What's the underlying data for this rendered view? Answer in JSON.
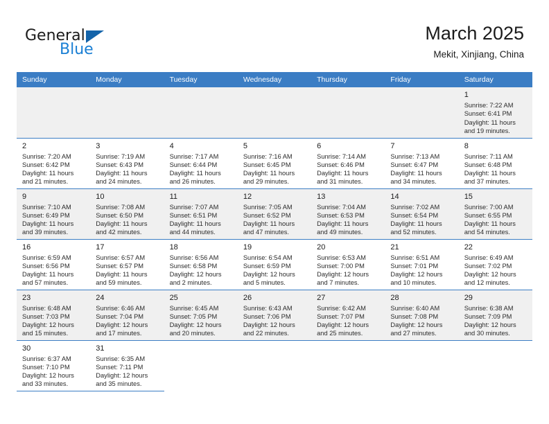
{
  "brand": {
    "name_part1": "General",
    "name_part2": "Blue",
    "triangle_color": "#1464aa",
    "blue_color": "#1a7fd4"
  },
  "header": {
    "title": "March 2025",
    "subtitle": "Mekit, Xinjiang, China"
  },
  "theme": {
    "header_bg": "#3b7dc4",
    "row_shade": "#f0f0f0",
    "grid_line": "#3b7dc4"
  },
  "weekdays": [
    "Sunday",
    "Monday",
    "Tuesday",
    "Wednesday",
    "Thursday",
    "Friday",
    "Saturday"
  ],
  "weeks": [
    [
      {
        "blank": true
      },
      {
        "blank": true
      },
      {
        "blank": true
      },
      {
        "blank": true
      },
      {
        "blank": true
      },
      {
        "blank": true
      },
      {
        "day": "1",
        "sunrise": "Sunrise: 7:22 AM",
        "sunset": "Sunset: 6:41 PM",
        "daylight1": "Daylight: 11 hours",
        "daylight2": "and 19 minutes."
      }
    ],
    [
      {
        "day": "2",
        "sunrise": "Sunrise: 7:20 AM",
        "sunset": "Sunset: 6:42 PM",
        "daylight1": "Daylight: 11 hours",
        "daylight2": "and 21 minutes."
      },
      {
        "day": "3",
        "sunrise": "Sunrise: 7:19 AM",
        "sunset": "Sunset: 6:43 PM",
        "daylight1": "Daylight: 11 hours",
        "daylight2": "and 24 minutes."
      },
      {
        "day": "4",
        "sunrise": "Sunrise: 7:17 AM",
        "sunset": "Sunset: 6:44 PM",
        "daylight1": "Daylight: 11 hours",
        "daylight2": "and 26 minutes."
      },
      {
        "day": "5",
        "sunrise": "Sunrise: 7:16 AM",
        "sunset": "Sunset: 6:45 PM",
        "daylight1": "Daylight: 11 hours",
        "daylight2": "and 29 minutes."
      },
      {
        "day": "6",
        "sunrise": "Sunrise: 7:14 AM",
        "sunset": "Sunset: 6:46 PM",
        "daylight1": "Daylight: 11 hours",
        "daylight2": "and 31 minutes."
      },
      {
        "day": "7",
        "sunrise": "Sunrise: 7:13 AM",
        "sunset": "Sunset: 6:47 PM",
        "daylight1": "Daylight: 11 hours",
        "daylight2": "and 34 minutes."
      },
      {
        "day": "8",
        "sunrise": "Sunrise: 7:11 AM",
        "sunset": "Sunset: 6:48 PM",
        "daylight1": "Daylight: 11 hours",
        "daylight2": "and 37 minutes."
      }
    ],
    [
      {
        "day": "9",
        "sunrise": "Sunrise: 7:10 AM",
        "sunset": "Sunset: 6:49 PM",
        "daylight1": "Daylight: 11 hours",
        "daylight2": "and 39 minutes."
      },
      {
        "day": "10",
        "sunrise": "Sunrise: 7:08 AM",
        "sunset": "Sunset: 6:50 PM",
        "daylight1": "Daylight: 11 hours",
        "daylight2": "and 42 minutes."
      },
      {
        "day": "11",
        "sunrise": "Sunrise: 7:07 AM",
        "sunset": "Sunset: 6:51 PM",
        "daylight1": "Daylight: 11 hours",
        "daylight2": "and 44 minutes."
      },
      {
        "day": "12",
        "sunrise": "Sunrise: 7:05 AM",
        "sunset": "Sunset: 6:52 PM",
        "daylight1": "Daylight: 11 hours",
        "daylight2": "and 47 minutes."
      },
      {
        "day": "13",
        "sunrise": "Sunrise: 7:04 AM",
        "sunset": "Sunset: 6:53 PM",
        "daylight1": "Daylight: 11 hours",
        "daylight2": "and 49 minutes."
      },
      {
        "day": "14",
        "sunrise": "Sunrise: 7:02 AM",
        "sunset": "Sunset: 6:54 PM",
        "daylight1": "Daylight: 11 hours",
        "daylight2": "and 52 minutes."
      },
      {
        "day": "15",
        "sunrise": "Sunrise: 7:00 AM",
        "sunset": "Sunset: 6:55 PM",
        "daylight1": "Daylight: 11 hours",
        "daylight2": "and 54 minutes."
      }
    ],
    [
      {
        "day": "16",
        "sunrise": "Sunrise: 6:59 AM",
        "sunset": "Sunset: 6:56 PM",
        "daylight1": "Daylight: 11 hours",
        "daylight2": "and 57 minutes."
      },
      {
        "day": "17",
        "sunrise": "Sunrise: 6:57 AM",
        "sunset": "Sunset: 6:57 PM",
        "daylight1": "Daylight: 11 hours",
        "daylight2": "and 59 minutes."
      },
      {
        "day": "18",
        "sunrise": "Sunrise: 6:56 AM",
        "sunset": "Sunset: 6:58 PM",
        "daylight1": "Daylight: 12 hours",
        "daylight2": "and 2 minutes."
      },
      {
        "day": "19",
        "sunrise": "Sunrise: 6:54 AM",
        "sunset": "Sunset: 6:59 PM",
        "daylight1": "Daylight: 12 hours",
        "daylight2": "and 5 minutes."
      },
      {
        "day": "20",
        "sunrise": "Sunrise: 6:53 AM",
        "sunset": "Sunset: 7:00 PM",
        "daylight1": "Daylight: 12 hours",
        "daylight2": "and 7 minutes."
      },
      {
        "day": "21",
        "sunrise": "Sunrise: 6:51 AM",
        "sunset": "Sunset: 7:01 PM",
        "daylight1": "Daylight: 12 hours",
        "daylight2": "and 10 minutes."
      },
      {
        "day": "22",
        "sunrise": "Sunrise: 6:49 AM",
        "sunset": "Sunset: 7:02 PM",
        "daylight1": "Daylight: 12 hours",
        "daylight2": "and 12 minutes."
      }
    ],
    [
      {
        "day": "23",
        "sunrise": "Sunrise: 6:48 AM",
        "sunset": "Sunset: 7:03 PM",
        "daylight1": "Daylight: 12 hours",
        "daylight2": "and 15 minutes."
      },
      {
        "day": "24",
        "sunrise": "Sunrise: 6:46 AM",
        "sunset": "Sunset: 7:04 PM",
        "daylight1": "Daylight: 12 hours",
        "daylight2": "and 17 minutes."
      },
      {
        "day": "25",
        "sunrise": "Sunrise: 6:45 AM",
        "sunset": "Sunset: 7:05 PM",
        "daylight1": "Daylight: 12 hours",
        "daylight2": "and 20 minutes."
      },
      {
        "day": "26",
        "sunrise": "Sunrise: 6:43 AM",
        "sunset": "Sunset: 7:06 PM",
        "daylight1": "Daylight: 12 hours",
        "daylight2": "and 22 minutes."
      },
      {
        "day": "27",
        "sunrise": "Sunrise: 6:42 AM",
        "sunset": "Sunset: 7:07 PM",
        "daylight1": "Daylight: 12 hours",
        "daylight2": "and 25 minutes."
      },
      {
        "day": "28",
        "sunrise": "Sunrise: 6:40 AM",
        "sunset": "Sunset: 7:08 PM",
        "daylight1": "Daylight: 12 hours",
        "daylight2": "and 27 minutes."
      },
      {
        "day": "29",
        "sunrise": "Sunrise: 6:38 AM",
        "sunset": "Sunset: 7:09 PM",
        "daylight1": "Daylight: 12 hours",
        "daylight2": "and 30 minutes."
      }
    ],
    [
      {
        "day": "30",
        "sunrise": "Sunrise: 6:37 AM",
        "sunset": "Sunset: 7:10 PM",
        "daylight1": "Daylight: 12 hours",
        "daylight2": "and 33 minutes."
      },
      {
        "day": "31",
        "sunrise": "Sunrise: 6:35 AM",
        "sunset": "Sunset: 7:11 PM",
        "daylight1": "Daylight: 12 hours",
        "daylight2": "and 35 minutes."
      },
      {
        "empty": true
      },
      {
        "empty": true
      },
      {
        "empty": true
      },
      {
        "empty": true
      },
      {
        "empty": true
      }
    ]
  ]
}
